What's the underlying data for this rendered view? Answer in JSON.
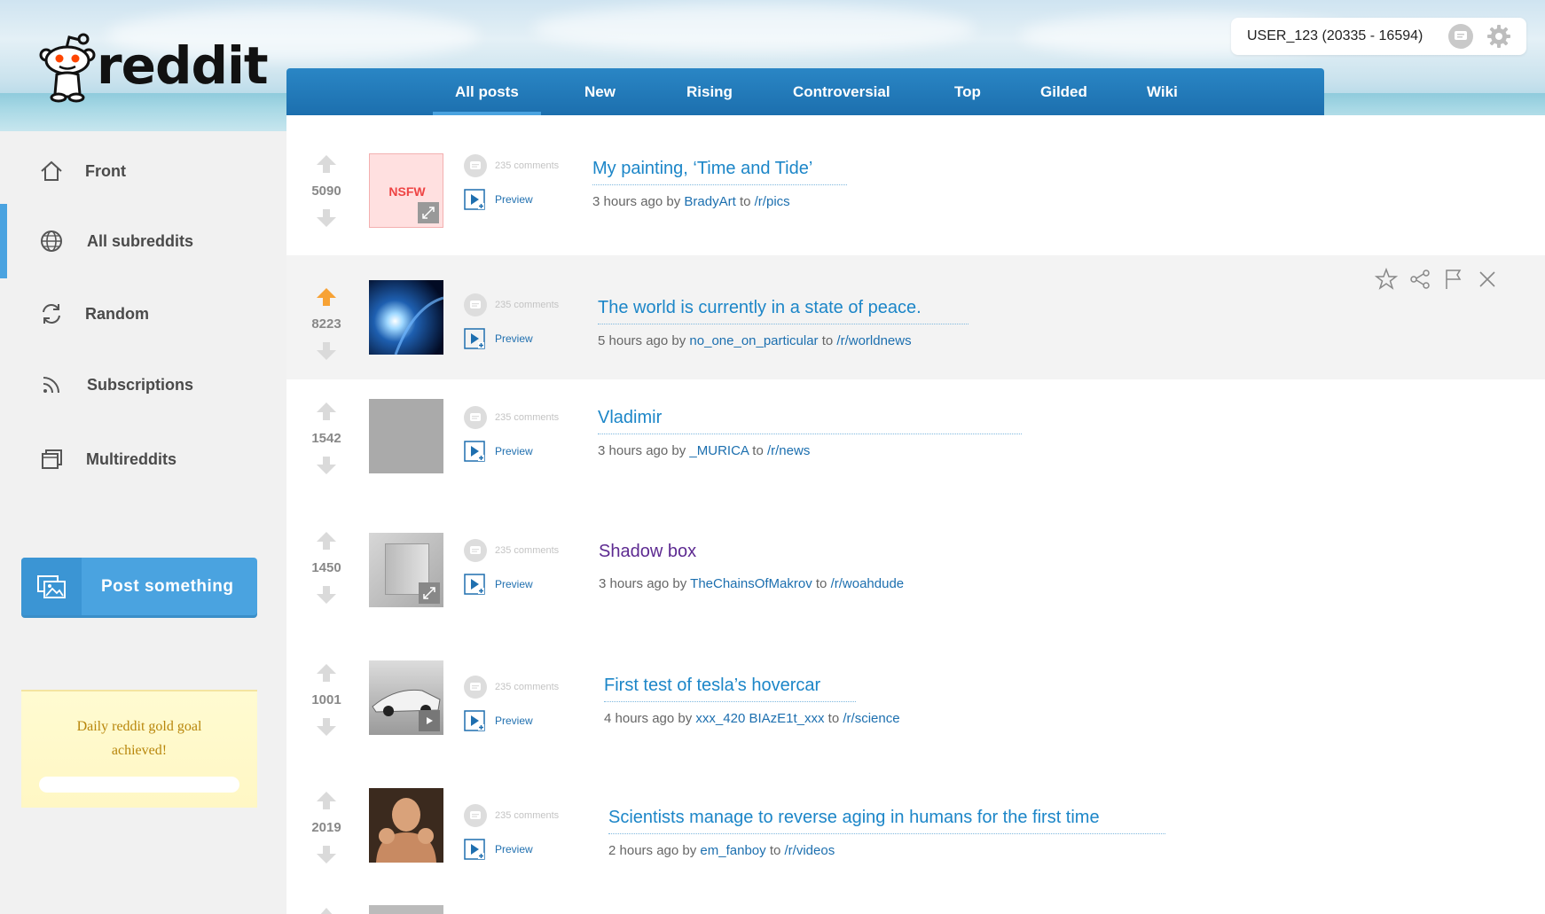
{
  "brand": {
    "name": "reddit"
  },
  "user": {
    "label": "USER_123 (20335 - 16594)"
  },
  "tabs": [
    "All posts",
    "New",
    "Rising",
    "Controversial",
    "Top",
    "Gilded",
    "Wiki"
  ],
  "active_tab": "All posts",
  "sidebar": {
    "items": [
      {
        "label": "Front",
        "icon": "home-icon"
      },
      {
        "label": "All subreddits",
        "icon": "globe-icon"
      },
      {
        "label": "Random",
        "icon": "refresh-icon"
      },
      {
        "label": "Subscriptions",
        "icon": "rss-icon"
      },
      {
        "label": "Multireddits",
        "icon": "stack-icon"
      }
    ],
    "active": "All subreddits",
    "post_button": "Post something",
    "gold_goal": {
      "line1": "Daily reddit gold goal",
      "line2": "achieved!",
      "progress": 1.0
    }
  },
  "posts": [
    {
      "score": "5090",
      "comments": "235 comments",
      "preview": "Preview",
      "thumb": "nsfw",
      "thumb_label": "NSFW",
      "title": "My painting, ‘Time and Tide’",
      "age": "3 hours ago by",
      "author": "BradyArt",
      "to": "to",
      "sub": "/r/pics",
      "voted": "none"
    },
    {
      "score": "8223",
      "comments": "235 comments",
      "preview": "Preview",
      "thumb": "earth",
      "title": "The world is currently in a state of peace.",
      "age": "5 hours ago by",
      "author": "no_one_on_particular",
      "to": "to",
      "sub": "/r/worldnews",
      "voted": "up",
      "highlighted": true
    },
    {
      "score": "1542",
      "comments": "235 comments",
      "preview": "Preview",
      "thumb": "gray",
      "title": "Vladimir",
      "age": "3 hours ago by",
      "author": "_MURICA",
      "to": "to",
      "sub": "/r/news",
      "voted": "none"
    },
    {
      "score": "1450",
      "comments": "235 comments",
      "preview": "Preview",
      "thumb": "box",
      "title": "Shadow box",
      "age": "3 hours ago by",
      "author": "TheChainsOfMakrov",
      "to": "to",
      "sub": "/r/woahdude",
      "voted": "none",
      "visited": true
    },
    {
      "score": "1001",
      "comments": "235 comments",
      "preview": "Preview",
      "thumb": "car",
      "title": "First test of tesla’s hovercar",
      "age": "4 hours ago by",
      "author": "xxx_420 BIAzE1t_xxx",
      "to": "to",
      "sub": "/r/science",
      "voted": "none"
    },
    {
      "score": "2019",
      "comments": "235 comments",
      "preview": "Preview",
      "thumb": "man",
      "title": "Scientists manage to reverse aging in humans for the first time",
      "age": "2 hours ago by",
      "author": "em_fanboy",
      "to": "to",
      "sub": "/r/videos",
      "voted": "none"
    }
  ],
  "colors": {
    "tab_bar": "#1f75b5",
    "accent": "#4aa3e0",
    "link": "#1c86c8",
    "visited": "#5d2a91",
    "upvote": "#f7a234"
  }
}
